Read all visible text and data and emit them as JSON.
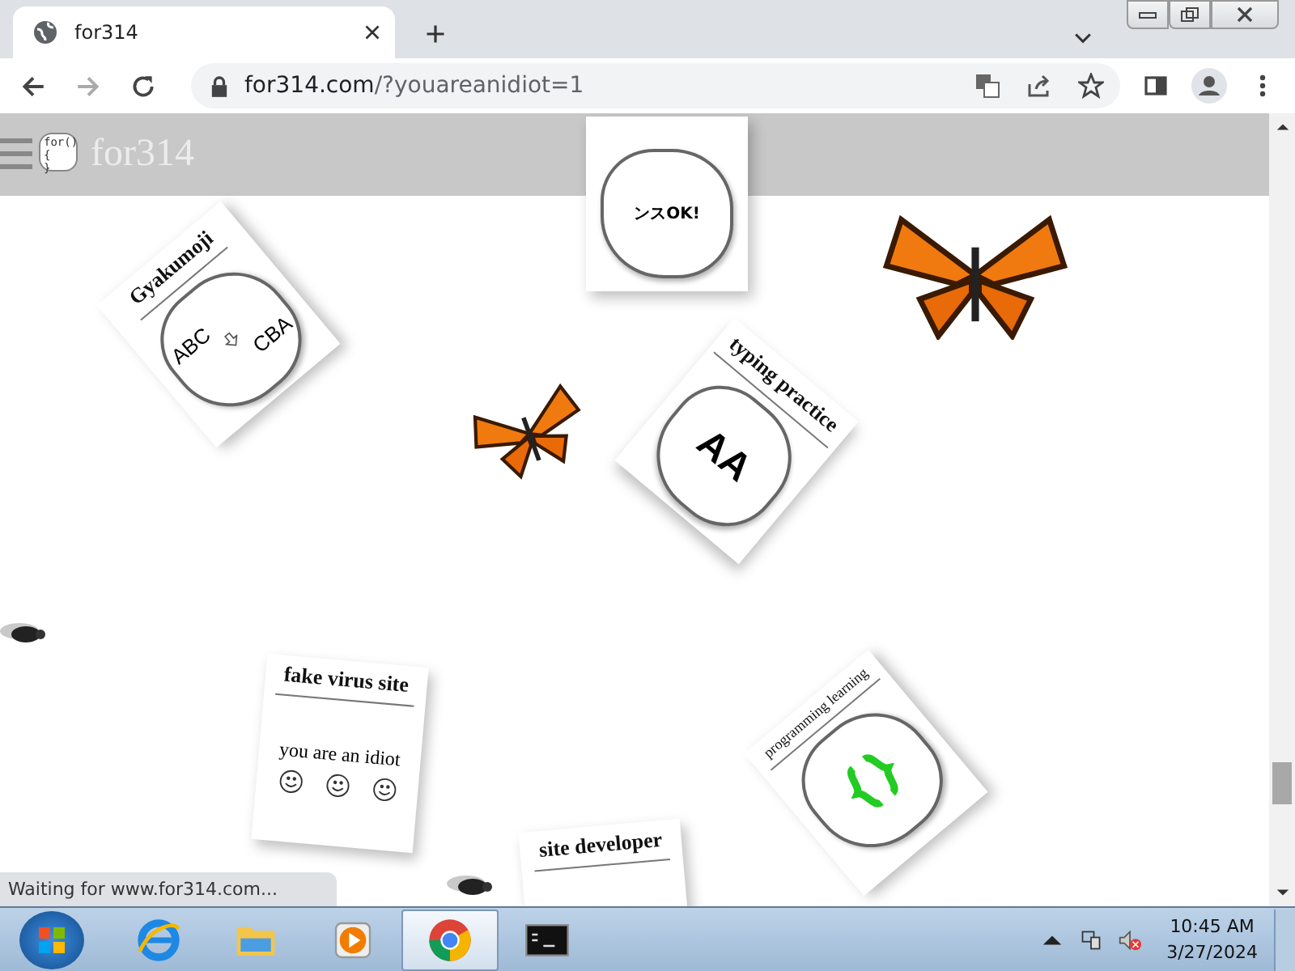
{
  "browser": {
    "tab": {
      "title": "for314"
    },
    "address": {
      "domain": "for314.com",
      "path": "/?youareanidiot=1"
    },
    "status": "Waiting for www.for314.com..."
  },
  "site": {
    "logo": {
      "line1": "for(){",
      "line2": "}"
    },
    "title": "for314"
  },
  "cards": [
    {
      "kind": "reverse",
      "title": "Gyakumoji",
      "top": "ABC",
      "bottom": "CBA"
    },
    {
      "kind": "partial",
      "text": "ンスOK!"
    },
    {
      "kind": "typing",
      "title": "typing practice",
      "text": "AA"
    },
    {
      "kind": "virus",
      "title": "fake virus site",
      "caption": "you are an idiot"
    },
    {
      "kind": "code",
      "title": "programming learning"
    },
    {
      "kind": "developer",
      "title": "site developer"
    }
  ],
  "taskbar": {
    "apps": [
      {
        "kind": "ie",
        "selected": false
      },
      {
        "kind": "folder",
        "selected": false
      },
      {
        "kind": "media",
        "selected": false
      },
      {
        "kind": "chrome",
        "selected": true
      },
      {
        "kind": "cmd",
        "selected": false
      }
    ],
    "time": "10:45 AM",
    "date": "3/27/2024"
  }
}
